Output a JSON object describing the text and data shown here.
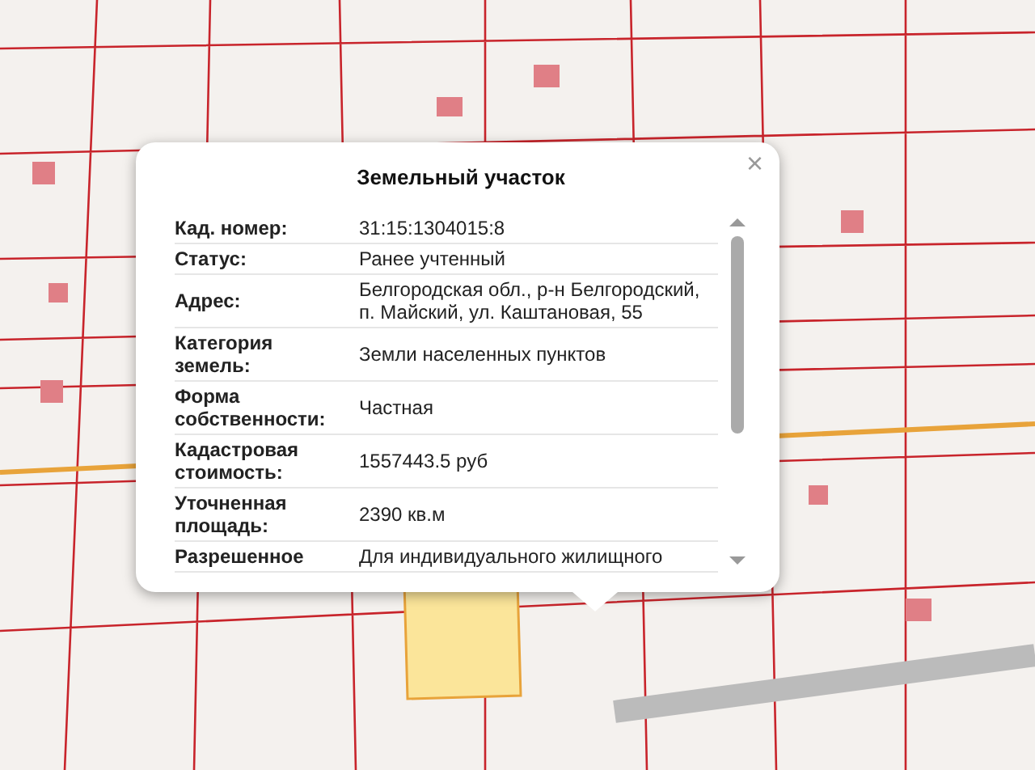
{
  "popup": {
    "title": "Земельный участок",
    "close": "×",
    "rows": [
      {
        "label": "Кад. номер:",
        "value": "31:15:1304015:8"
      },
      {
        "label": "Статус:",
        "value": "Ранее учтенный"
      },
      {
        "label": "Адрес:",
        "value": "Белгородская обл., р-н Белгородский, п. Майский, ул. Каштановая, 55"
      },
      {
        "label": "Категория земель:",
        "value": "Земли населенных пунктов"
      },
      {
        "label": "Форма собственности:",
        "value": "Частная"
      },
      {
        "label": "Кадастровая стоимость:",
        "value": "1557443.5 руб"
      },
      {
        "label": "Уточненная площадь:",
        "value": "2390 кв.м"
      },
      {
        "label": "Разрешенное",
        "value": "Для индивидуального жилищного"
      }
    ]
  }
}
